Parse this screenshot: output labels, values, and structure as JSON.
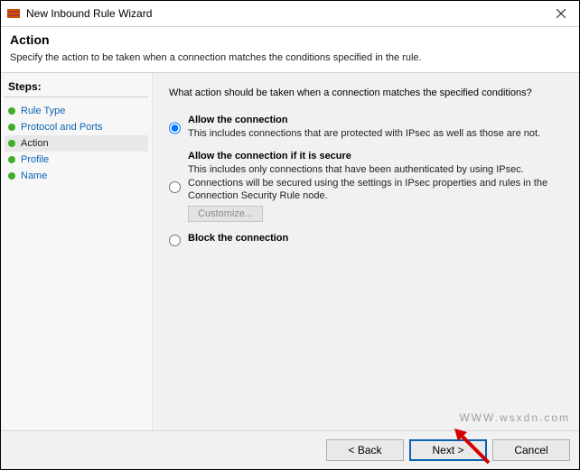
{
  "window": {
    "title": "New Inbound Rule Wizard"
  },
  "header": {
    "heading": "Action",
    "subhead": "Specify the action to be taken when a connection matches the conditions specified in the rule."
  },
  "sidebar": {
    "steps_title": "Steps:",
    "items": [
      {
        "label": "Rule Type",
        "selected": false
      },
      {
        "label": "Protocol and Ports",
        "selected": false
      },
      {
        "label": "Action",
        "selected": true
      },
      {
        "label": "Profile",
        "selected": false
      },
      {
        "label": "Name",
        "selected": false
      }
    ]
  },
  "content": {
    "prompt": "What action should be taken when a connection matches the specified conditions?",
    "options": [
      {
        "title": "Allow the connection",
        "desc": "This includes connections that are protected with IPsec as well as those are not.",
        "checked": true
      },
      {
        "title": "Allow the connection if it is secure",
        "desc": "This includes only connections that have been authenticated by using IPsec.  Connections will be secured using the settings in IPsec properties and rules in the Connection Security Rule node.",
        "checked": false
      },
      {
        "title": "Block the connection",
        "desc": "",
        "checked": false
      }
    ],
    "customize_label": "Customize..."
  },
  "footer": {
    "back_label": "< Back",
    "next_label": "Next >",
    "cancel_label": "Cancel"
  },
  "watermark": "WWW.wsxdn.com"
}
